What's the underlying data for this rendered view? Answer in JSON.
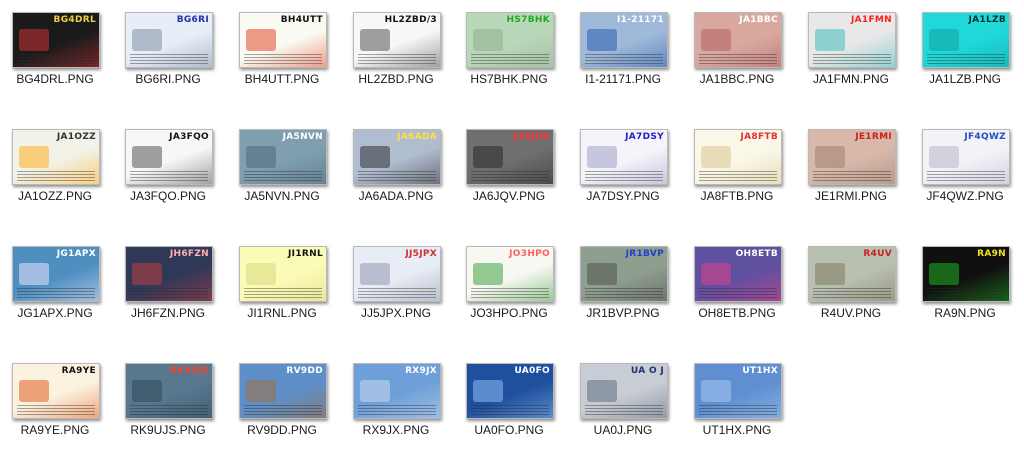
{
  "files": [
    {
      "name": "BG4DRL.PNG",
      "callsign": "BG4DRL",
      "bg": "#1a1a1a",
      "fg": "#f0d040",
      "accent": "#cc3333"
    },
    {
      "name": "BG6RI.PNG",
      "callsign": "BG6RI",
      "bg": "#e8eef8",
      "fg": "#2233aa",
      "accent": "#7f8fa6"
    },
    {
      "name": "BH4UTT.PNG",
      "callsign": "BH4UTT",
      "bg": "#fbfbf3",
      "fg": "#111111",
      "accent": "#e04a2a"
    },
    {
      "name": "HL2ZBD.PNG",
      "callsign": "HL2ZBD/3",
      "bg": "#f7f7f7",
      "fg": "#111111",
      "accent": "#555555"
    },
    {
      "name": "HS7BHK.PNG",
      "callsign": "HS7BHK",
      "bg": "#b9d7b9",
      "fg": "#22aa22",
      "accent": "#8fb08f"
    },
    {
      "name": "I1-21171.PNG",
      "callsign": "I1-21171",
      "bg": "#9fb9d9",
      "fg": "#ffffff",
      "accent": "#2a5fb0"
    },
    {
      "name": "JA1BBC.PNG",
      "callsign": "JA1BBC",
      "bg": "#d9a9a0",
      "fg": "#ffffff",
      "accent": "#b06060"
    },
    {
      "name": "JA1FMN.PNG",
      "callsign": "JA1FMN",
      "bg": "#e8e8e8",
      "fg": "#ff2020",
      "accent": "#44bcbc"
    },
    {
      "name": "JA1LZB.PNG",
      "callsign": "JA1LZB",
      "bg": "#20d8d8",
      "fg": "#003333",
      "accent": "#10a0a0"
    },
    {
      "name": "JA1OZZ.PNG",
      "callsign": "JA1OZZ",
      "bg": "#f2f2e8",
      "fg": "#333333",
      "accent": "#ffb020"
    },
    {
      "name": "JA3FQO.PNG",
      "callsign": "JA3FQO",
      "bg": "#f7f7f7",
      "fg": "#111111",
      "accent": "#555555"
    },
    {
      "name": "JA5NVN.PNG",
      "callsign": "JA5NVN",
      "bg": "#7f9fb0",
      "fg": "#ffffff",
      "accent": "#506878"
    },
    {
      "name": "JA6ADA.PNG",
      "callsign": "JA6ADA",
      "bg": "#b0bcd0",
      "fg": "#ffe040",
      "accent": "#303030"
    },
    {
      "name": "JA6JQV.PNG",
      "callsign": "JA6JQV",
      "bg": "#6f6f6f",
      "fg": "#ff3030",
      "accent": "#2a2a2a"
    },
    {
      "name": "JA7DSY.PNG",
      "callsign": "JA7DSY",
      "bg": "#f4f4fa",
      "fg": "#2020cc",
      "accent": "#a0a0c8"
    },
    {
      "name": "JA8FTB.PNG",
      "callsign": "JA8FTB",
      "bg": "#fbf7e8",
      "fg": "#e03030",
      "accent": "#d8c890"
    },
    {
      "name": "JE1RMI.PNG",
      "callsign": "JE1RMI",
      "bg": "#d8b8a8",
      "fg": "#cc2020",
      "accent": "#a08070"
    },
    {
      "name": "JF4QWZ.PNG",
      "callsign": "JF4QWZ",
      "bg": "#f2f2f8",
      "fg": "#2050c0",
      "accent": "#b8b8c8"
    },
    {
      "name": "JG1APX.PNG",
      "callsign": "JG1APX",
      "bg": "#4f8fc0",
      "fg": "#ffffff",
      "accent": "#e8e8ff"
    },
    {
      "name": "JH6FZN.PNG",
      "callsign": "JH6FZN",
      "bg": "#303858",
      "fg": "#ffb0b0",
      "accent": "#c04040"
    },
    {
      "name": "JI1RNL.PNG",
      "callsign": "JI1RNL",
      "bg": "#fbfbb8",
      "fg": "#111111",
      "accent": "#d8d880"
    },
    {
      "name": "JJ5JPX.PNG",
      "callsign": "JJ5JPX",
      "bg": "#e8ecf4",
      "fg": "#cc3030",
      "accent": "#9098b0"
    },
    {
      "name": "JO3HPO.PNG",
      "callsign": "JO3HPO",
      "bg": "#f8f8f2",
      "fg": "#ff6060",
      "accent": "#40a040"
    },
    {
      "name": "JR1BVP.PNG",
      "callsign": "JR1BVP",
      "bg": "#8f9f8f",
      "fg": "#2040d0",
      "accent": "#505050"
    },
    {
      "name": "OH8ETB.PNG",
      "callsign": "OH8ETB",
      "bg": "#6050a0",
      "fg": "#ffffff",
      "accent": "#e0408a"
    },
    {
      "name": "R4UV.PNG",
      "callsign": "R4UV",
      "bg": "#b8c0b0",
      "fg": "#cc2020",
      "accent": "#807860"
    },
    {
      "name": "RA9N.PNG",
      "callsign": "RA9N",
      "bg": "#101010",
      "fg": "#f0e020",
      "accent": "#20b020"
    },
    {
      "name": "RA9YE.PNG",
      "callsign": "RA9YE",
      "bg": "#fbf2e0",
      "fg": "#111111",
      "accent": "#e06020"
    },
    {
      "name": "RK9UJS.PNG",
      "callsign": "RK9UJS",
      "bg": "#587890",
      "fg": "#ff4020",
      "accent": "#304858"
    },
    {
      "name": "RV9DD.PNG",
      "callsign": "RV9DD",
      "bg": "#5f8fc8",
      "fg": "#ffffff",
      "accent": "#a07040"
    },
    {
      "name": "RX9JX.PNG",
      "callsign": "RX9JX",
      "bg": "#6f9fd8",
      "fg": "#ffffff",
      "accent": "#c8d8f0"
    },
    {
      "name": "UA0FO.PNG",
      "callsign": "UA0FO",
      "bg": "#1f4f9f",
      "fg": "#ffffff",
      "accent": "#90c0f0"
    },
    {
      "name": "UA0J.PNG",
      "callsign": "UA O J",
      "bg": "#c8ccd4",
      "fg": "#203070",
      "accent": "#607080"
    },
    {
      "name": "UT1HX.PNG",
      "callsign": "UT1HX",
      "bg": "#5f8fd0",
      "fg": "#ffffff",
      "accent": "#a8c8f0"
    }
  ]
}
